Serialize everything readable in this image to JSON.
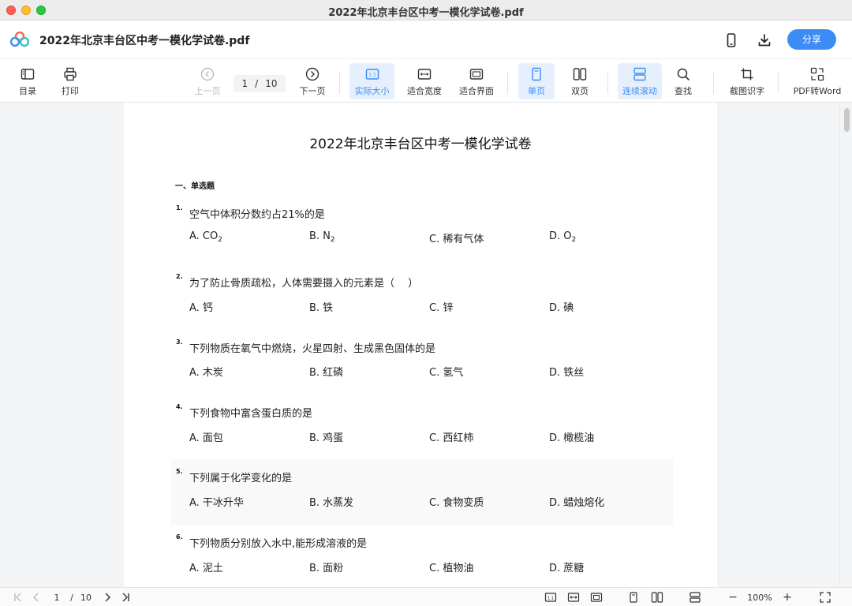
{
  "window": {
    "title": "2022年北京丰台区中考一模化学试卷.pdf"
  },
  "header": {
    "doc_name": "2022年北京丰台区中考一模化学试卷.pdf",
    "share_label": "分享",
    "icons": [
      "app-logo-icon",
      "mobile-icon",
      "download-icon"
    ]
  },
  "toolbar": {
    "toc": "目录",
    "print": "打印",
    "prev_page": "上一页",
    "current_page": "1",
    "page_separator": "/",
    "total_pages": "10",
    "next_page": "下一页",
    "actual_size": "实际大小",
    "fit_width": "适合宽度",
    "fit_page": "适合界面",
    "single_page": "单页",
    "double_page": "双页",
    "continuous_scroll": "连续滚动",
    "find": "查找",
    "ocr": "截图识字",
    "pdf_to_word": "PDF转Word",
    "active": [
      "实际大小",
      "单页",
      "连续滚动"
    ]
  },
  "document": {
    "title": "2022年北京丰台区中考一模化学试卷",
    "section": "一、单选题",
    "questions": [
      {
        "num": "1.",
        "text": "空气中体积分数约占21%的是",
        "options": [
          "A. CO",
          "B. N",
          "C. 稀有气体",
          "D. O"
        ],
        "subscripts": [
          "2",
          "2",
          "",
          "2"
        ]
      },
      {
        "num": "2.",
        "text": "为了防止骨质疏松，人体需要摄入的元素是（　 ）",
        "options": [
          "A. 钙",
          "B. 铁",
          "C. 锌",
          "D. 碘"
        ]
      },
      {
        "num": "3.",
        "text": "下列物质在氧气中燃烧，火星四射、生成黑色固体的是",
        "options": [
          "A. 木炭",
          "B. 红磷",
          "C. 氢气",
          "D. 铁丝"
        ]
      },
      {
        "num": "4.",
        "text": "下列食物中富含蛋白质的是",
        "options": [
          "A. 面包",
          "B. 鸡蛋",
          "C. 西红柿",
          "D. 橄榄油"
        ]
      },
      {
        "num": "5.",
        "text": "下列属于化学变化的是",
        "options": [
          "A. 干冰升华",
          "B. 水蒸发",
          "C. 食物变质",
          "D. 蜡烛熔化"
        ]
      },
      {
        "num": "6.",
        "text": "下列物质分别放入水中,能形成溶液的是",
        "options": [
          "A. 泥土",
          "B. 面粉",
          "C. 植物油",
          "D. 蔗糖"
        ]
      }
    ]
  },
  "statusbar": {
    "current_page": "1",
    "page_separator": "/",
    "total_pages": "10",
    "zoom": "100%",
    "zoom_out": "−",
    "zoom_in": "+"
  }
}
